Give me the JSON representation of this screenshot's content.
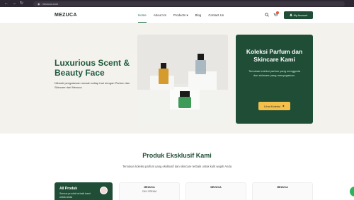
{
  "browser": {
    "url": "mezuca.com"
  },
  "header": {
    "logo": "MEZUCA",
    "nav": [
      "Home",
      "About Us",
      "Products",
      "Blog",
      "Contact Us"
    ],
    "products_caret": "▾",
    "account_label": "My Account"
  },
  "hero": {
    "title": "Luxurious Scent & Beauty Face",
    "description": "Nikmati pengalaman mewah setiap hari dengan Parfum dan Skincare dari Mezuca"
  },
  "promo": {
    "title": "Koleksi Parfum dan Skincare Kami",
    "description": "Temukan koleksi parfum yang menggoda dan skincare yang menyegarkan.",
    "button": "Lihat Koleksi"
  },
  "section": {
    "title": "Produk Eksklusif Kami",
    "subtitle": "Temukan koleksi parfum yang eksklusif dan skincare terbaik untuk kulit wajah Anda"
  },
  "category": {
    "title": "All Produk",
    "description": "Semua produk terbaik kami untuk Anda"
  },
  "products": [
    {
      "brand": "MEZUCA",
      "name": "DAY CREAM"
    },
    {
      "brand": "MEZUCA",
      "name": ""
    },
    {
      "brand": "MEZUCA",
      "name": ""
    }
  ],
  "colors": {
    "brand_green": "#1f4d35",
    "accent_yellow": "#f4c04a",
    "hero_bg": "#f3f2ec"
  }
}
